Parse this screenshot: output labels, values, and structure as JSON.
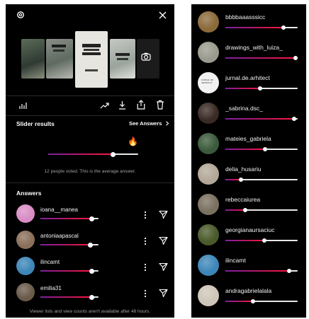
{
  "left_panel": {
    "slider_results_label": "Slider results",
    "see_answers_label": "See Answers",
    "average_emoji": "🔥",
    "average_value": 0.72,
    "votes_caption": "12 people voted. This is the average answer.",
    "answers_heading": "Answers",
    "answers": [
      {
        "username": "ioana__manea",
        "value": 0.88,
        "avatar_color": "#d98cc4"
      },
      {
        "username": "antoniaapascal",
        "value": 0.85,
        "avatar_color": "#8a6f5a"
      },
      {
        "username": "ilincamt",
        "value": 0.88,
        "avatar_color": "#3d86b8"
      },
      {
        "username": "emilia31",
        "value": 0.88,
        "avatar_color": "#6b5a4a"
      }
    ],
    "footer_note": "Viewer lists and view counts aren't available after 48 hours."
  },
  "right_panel": {
    "rows": [
      {
        "username": "bbbbaaasssicc",
        "value": 0.8,
        "avatar_color": "#8c6a3a"
      },
      {
        "username": "drawings_with_luiza_",
        "value": 0.97,
        "avatar_color": "#9a9a8e"
      },
      {
        "username": "jurnal.de.arhitect",
        "value": 0.48,
        "avatar_color": "#f2f2f2",
        "avatar_text": "JURNAL DE ARHITECT"
      },
      {
        "username": "_sabrina.dsc_",
        "value": 0.95,
        "avatar_color": "#3a2a24"
      },
      {
        "username": "mateies_gabriela",
        "value": 0.55,
        "avatar_color": "#3b5a3b"
      },
      {
        "username": "delia_husariu",
        "value": 0.22,
        "avatar_color": "#b3a898"
      },
      {
        "username": "rebeccaiurea",
        "value": 0.27,
        "avatar_color": "#7a7060"
      },
      {
        "username": "georgianaursaciuc",
        "value": 0.54,
        "avatar_color": "#4a5a2a"
      },
      {
        "username": "ilincamt",
        "value": 0.88,
        "avatar_color": "#3d86b8"
      },
      {
        "username": "andragabrielalala",
        "value": 0.38,
        "avatar_color": "#cfc5b8"
      }
    ]
  },
  "colors": {
    "background": "#000000",
    "slider_gradient_start": "#7b1fa2",
    "slider_gradient_end": "#ff1744"
  },
  "icons": {
    "top_left": "settings-icon",
    "top_right": "close-icon",
    "camera": "camera-icon",
    "stats": "bar-chart-icon",
    "trend": "trending-icon",
    "download": "download-icon",
    "share": "share-icon",
    "delete": "trash-icon",
    "chevron": "chevron-right-icon",
    "more": "more-vertical-icon",
    "send": "send-icon"
  }
}
